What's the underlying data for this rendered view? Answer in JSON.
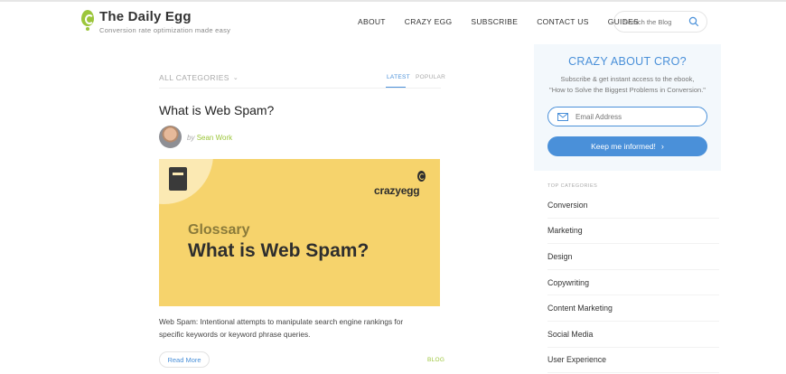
{
  "header": {
    "logo_title": "The Daily Egg",
    "logo_tagline": "Conversion rate optimization made easy",
    "nav": [
      {
        "label": "ABOUT"
      },
      {
        "label": "CRAZY EGG"
      },
      {
        "label": "SUBSCRIBE"
      },
      {
        "label": "CONTACT US"
      },
      {
        "label": "GUIDES"
      }
    ],
    "search_placeholder": "Search the Blog",
    "search_icon": "search-icon"
  },
  "filters": {
    "category_dropdown": "ALL CATEGORIES",
    "tabs": {
      "latest": "LATEST",
      "popular": "POPULAR"
    },
    "active_tab": "LATEST"
  },
  "article": {
    "title": "What is Web Spam?",
    "by": "by",
    "author": "Sean Work",
    "hero": {
      "brand": "crazyegg",
      "kicker": "Glossary",
      "headline": "What is Web Spam?"
    },
    "excerpt": "Web Spam: Intentional attempts to manipulate search engine rankings for specific keywords or keyword phrase queries.",
    "read_more": "Read More",
    "tag": "BLOG"
  },
  "sidebar": {
    "cro": {
      "title": "CRAZY ABOUT CRO?",
      "desc_line1": "Subscribe & get instant access to the ebook,",
      "desc_line2": "\"How to Solve the Biggest Problems in Conversion.\"",
      "email_placeholder": "Email Address",
      "cta_label": "Keep me informed!"
    },
    "top_categories_label": "TOP CATEGORIES",
    "categories": [
      "Conversion",
      "Marketing",
      "Design",
      "Copywriting",
      "Content Marketing",
      "Social Media",
      "User Experience"
    ]
  },
  "colors": {
    "accent_blue": "#4a90d9",
    "accent_green": "#9cc63b",
    "hero_yellow": "#f6d36c",
    "sidebar_bg": "#f3f8fc"
  }
}
